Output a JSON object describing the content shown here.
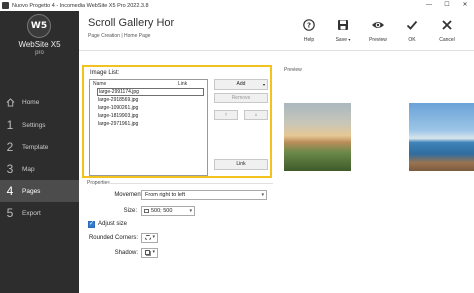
{
  "window": {
    "title": "Nuovo Progetto 4 - Incomedia WebSite X5 Pro 2022.3.8",
    "minimize": "—",
    "maximize": "☐",
    "close": "✕"
  },
  "brand": {
    "logo_mark": "W5",
    "name": "WebSite X5",
    "edition": "pro"
  },
  "nav": [
    {
      "num": "",
      "label": "Home",
      "icon": "home-icon"
    },
    {
      "num": "1",
      "label": "Settings"
    },
    {
      "num": "2",
      "label": "Template"
    },
    {
      "num": "3",
      "label": "Map"
    },
    {
      "num": "4",
      "label": "Pages",
      "active": true
    },
    {
      "num": "5",
      "label": "Export"
    }
  ],
  "header": {
    "title": "Scroll Gallery Hor",
    "breadcrumb": "Page Creation | Home Page"
  },
  "toolbar": {
    "help": "Help",
    "save": "Save",
    "preview": "Preview",
    "ok": "OK",
    "cancel": "Cancel"
  },
  "image_list": {
    "label": "Image List:",
    "col_name": "Name",
    "col_link": "Link",
    "items": [
      "large-2991174.jpg",
      "large-2918569.jpg",
      "large-1090261.jpg",
      "large-1819903.jpg",
      "large-2971961.jpg"
    ],
    "selected_index": 0,
    "add": "Add",
    "remove": "Remove",
    "move_up": "↑",
    "move_down": "↓",
    "link": "Link"
  },
  "preview": {
    "label": "Preview"
  },
  "properties": {
    "label": "Properties",
    "movement_label": "Movement:",
    "movement_value": "From right to left",
    "size_label": "Size:",
    "size_value": "500; 500",
    "adjust_size_label": "Adjust size",
    "adjust_size_checked": true,
    "rounded_label": "Rounded Corners:",
    "shadow_label": "Shadow:"
  },
  "colors": {
    "sidebar": "#2d2d2d",
    "sidebar_active": "#4c4c4c",
    "highlight": "#f2c31d",
    "checkbox": "#2f7bd6"
  }
}
